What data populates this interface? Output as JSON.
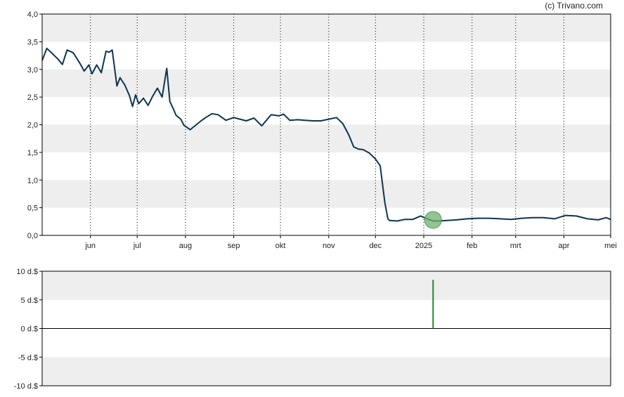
{
  "copyright": "(c) Trivano.com",
  "colors": {
    "band": "#eeeeee",
    "price_line": "#0d3550",
    "marker_fill": "#6fb26f",
    "volume_bar": "#1f8a2e",
    "axis": "#000000",
    "grid": "#000000"
  },
  "chart_data": [
    {
      "type": "line",
      "title": "",
      "xlabel": "",
      "ylabel": "",
      "x_ticks": [
        "jun",
        "jul",
        "aug",
        "sep",
        "okt",
        "nov",
        "dec",
        "2025",
        "feb",
        "mrt",
        "apr",
        "mei"
      ],
      "y_ticks": [
        "0,0",
        "0,5",
        "1,0",
        "1,5",
        "2,0",
        "2,5",
        "3,0",
        "3,5",
        "4,0"
      ],
      "ylim": [
        0,
        4
      ],
      "xlim": [
        "2024-05-01",
        "2025-05-01"
      ],
      "grid": "vertical dotted lines at month ticks; alternating horizontal bands",
      "series": [
        {
          "x": [
            "2024-05-01",
            "2024-05-04",
            "2024-05-07",
            "2024-05-11",
            "2024-05-14",
            "2024-05-17",
            "2024-05-21",
            "2024-05-25",
            "2024-05-28",
            "2024-05-31",
            "2024-06-02",
            "2024-06-05",
            "2024-06-08",
            "2024-06-11",
            "2024-06-13",
            "2024-06-15",
            "2024-06-18",
            "2024-06-20",
            "2024-06-23",
            "2024-06-26",
            "2024-06-28",
            "2024-06-30",
            "2024-07-02",
            "2024-07-05",
            "2024-07-08",
            "2024-07-11",
            "2024-07-14",
            "2024-07-17",
            "2024-07-20",
            "2024-07-22",
            "2024-07-24",
            "2024-07-26",
            "2024-07-29",
            "2024-07-31",
            "2024-08-04",
            "2024-08-08",
            "2024-08-11",
            "2024-08-14",
            "2024-08-18",
            "2024-08-22",
            "2024-08-27",
            "2024-09-01",
            "2024-09-05",
            "2024-09-09",
            "2024-09-14",
            "2024-09-19",
            "2024-09-25",
            "2024-09-30",
            "2024-10-03",
            "2024-10-07",
            "2024-10-12",
            "2024-10-17",
            "2024-10-22",
            "2024-10-27",
            "2024-11-01",
            "2024-11-06",
            "2024-11-10",
            "2024-11-14",
            "2024-11-17",
            "2024-11-20",
            "2024-11-23",
            "2024-11-27",
            "2024-12-01",
            "2024-12-04",
            "2024-12-07",
            "2024-12-09",
            "2024-12-10",
            "2024-12-15",
            "2024-12-20",
            "2024-12-25",
            "2024-12-30",
            "2025-01-03",
            "2025-01-07",
            "2025-01-11",
            "2025-01-16",
            "2025-01-22",
            "2025-01-29",
            "2025-02-05",
            "2025-02-12",
            "2025-02-19",
            "2025-02-26",
            "2025-03-05",
            "2025-03-12",
            "2025-03-19",
            "2025-03-26",
            "2025-04-02",
            "2025-04-09",
            "2025-04-16",
            "2025-04-23",
            "2025-04-28",
            "2025-05-01"
          ],
          "values": [
            3.16,
            3.38,
            3.3,
            3.19,
            3.09,
            3.35,
            3.3,
            3.12,
            2.97,
            3.08,
            2.92,
            3.08,
            2.94,
            3.33,
            3.31,
            3.35,
            2.7,
            2.85,
            2.72,
            2.53,
            2.33,
            2.54,
            2.38,
            2.48,
            2.35,
            2.52,
            2.66,
            2.5,
            3.02,
            2.42,
            2.3,
            2.17,
            2.1,
            1.99,
            1.91,
            2.0,
            2.07,
            2.13,
            2.2,
            2.18,
            2.08,
            2.13,
            2.1,
            2.07,
            2.12,
            1.98,
            2.18,
            2.16,
            2.19,
            2.08,
            2.09,
            2.08,
            2.07,
            2.07,
            2.1,
            2.13,
            2.02,
            1.81,
            1.6,
            1.56,
            1.55,
            1.49,
            1.38,
            1.26,
            0.6,
            0.3,
            0.27,
            0.26,
            0.29,
            0.29,
            0.35,
            0.3,
            0.26,
            0.26,
            0.27,
            0.28,
            0.3,
            0.31,
            0.31,
            0.3,
            0.29,
            0.31,
            0.32,
            0.32,
            0.3,
            0.36,
            0.35,
            0.3,
            0.28,
            0.32,
            0.29
          ]
        }
      ],
      "marker": {
        "x": "2025-01-07",
        "y": 0.28
      }
    },
    {
      "type": "bar",
      "title": "",
      "xlabel": "",
      "ylabel": "",
      "y_ticks": [
        "-10 d.$",
        "-5 d.$",
        "0 d.$",
        "5 d.$",
        "10 d.$"
      ],
      "ylim": [
        -10,
        10
      ],
      "grid": "alternating horizontal bands",
      "series": [
        {
          "x": [
            "2025-01-07"
          ],
          "values": [
            8.5
          ]
        }
      ]
    }
  ]
}
